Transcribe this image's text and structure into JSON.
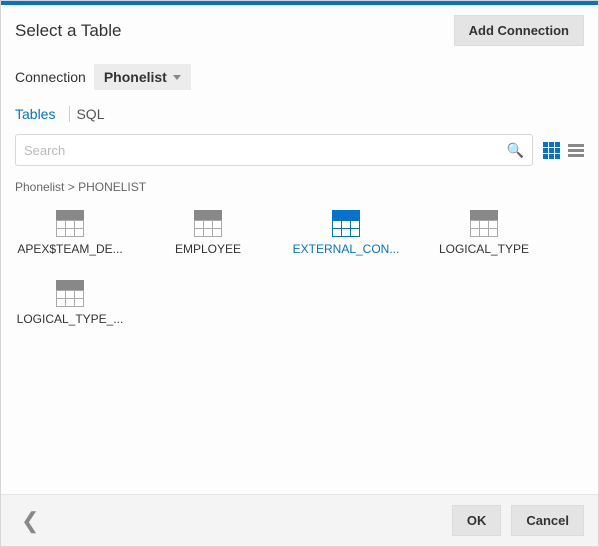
{
  "title": "Select a Table",
  "addConnectionLabel": "Add Connection",
  "connectionLabel": "Connection",
  "connectionValue": "Phonelist",
  "tabs": {
    "tables": "Tables",
    "sql": "SQL"
  },
  "search": {
    "placeholder": "Search"
  },
  "breadcrumb": {
    "root": "Phonelist",
    "sep": ">",
    "current": "PHONELIST"
  },
  "items": [
    {
      "label": "APEX$TEAM_DE...",
      "selected": false
    },
    {
      "label": "EMPLOYEE",
      "selected": false
    },
    {
      "label": "EXTERNAL_CON...",
      "selected": true
    },
    {
      "label": "LOGICAL_TYPE",
      "selected": false
    },
    {
      "label": "LOGICAL_TYPE_...",
      "selected": false
    }
  ],
  "footer": {
    "ok": "OK",
    "cancel": "Cancel"
  }
}
